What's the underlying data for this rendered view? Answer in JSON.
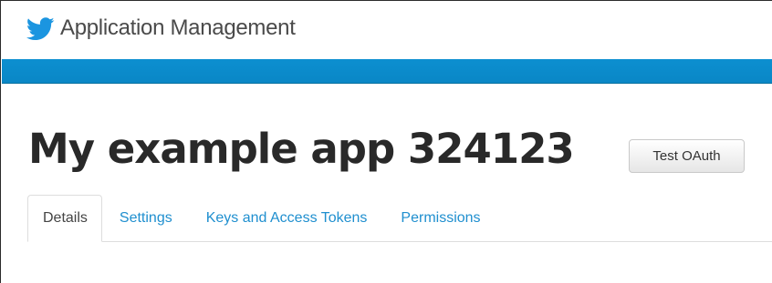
{
  "header": {
    "brand_icon": "twitter-bird-icon",
    "title": "Application Management"
  },
  "colors": {
    "bluebar": "#0a87c6",
    "brand_icon": "#1b95e0",
    "tab_link": "#1f8fcf"
  },
  "app": {
    "title": "My example app 324123",
    "test_oauth_label": "Test OAuth"
  },
  "tabs": [
    {
      "label": "Details",
      "active": true
    },
    {
      "label": "Settings",
      "active": false
    },
    {
      "label": "Keys and Access Tokens",
      "active": false
    },
    {
      "label": "Permissions",
      "active": false
    }
  ]
}
